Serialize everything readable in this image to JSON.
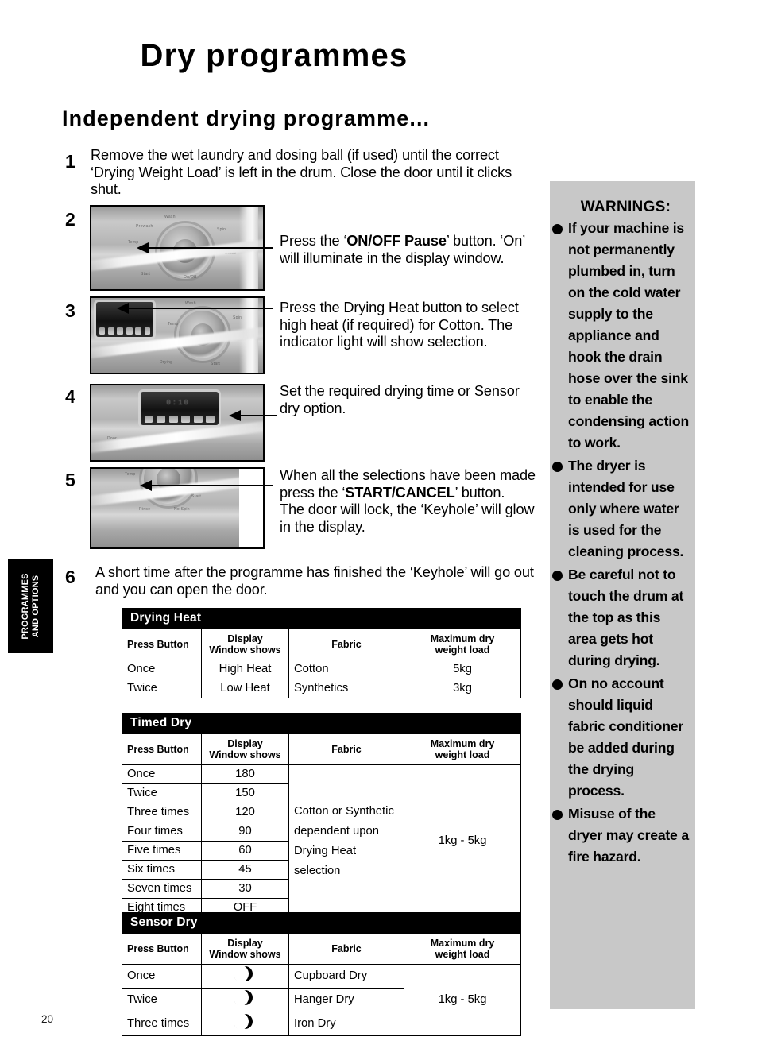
{
  "page": {
    "title": "Dry programmes",
    "section_heading": "Independent drying programme...",
    "page_number": "20",
    "side_tab_line1": "PROGRAMMES",
    "side_tab_line2": "AND OPTIONS"
  },
  "steps": [
    {
      "number": "1",
      "text": "Remove the wet laundry and dosing ball (if used) until the correct ‘Drying Weight Load’ is left in the drum. Close the door until it clicks shut."
    },
    {
      "number": "2",
      "text_lead": "Press the ‘",
      "text_bold": "ON/OFF Pause",
      "text_tail": "’ button. ‘On’ will illuminate in the display window.",
      "photo_alt": "washer-control-panel-dial"
    },
    {
      "number": "3",
      "text": "Press the Drying Heat button to select high heat (if required) for Cotton. The indicator light will show selection.",
      "photo_alt": "washer-control-panel-display"
    },
    {
      "number": "4",
      "text": "Set the required drying time or Sensor dry option.",
      "photo_alt": "washer-display-window-closeup"
    },
    {
      "number": "5",
      "text_lead": "When all the selections have been made press the ‘",
      "text_bold": "START/CANCEL",
      "text_tail": "’ button.",
      "text_line2": "The door will lock, the ‘Keyhole’ will glow in the display.",
      "photo_alt": "washer-control-panel-start-button"
    },
    {
      "number": "6",
      "text": "A short time after the programme has finished the ‘Keyhole’ will go out and you can open the door."
    }
  ],
  "tables": [
    {
      "title": "Drying Heat",
      "columns": [
        "Press Button",
        "Display\nWindow shows",
        "Fabric",
        "Maximum dry\nweight load"
      ],
      "col_head_1a": "Display",
      "col_head_1b": "Window shows",
      "col_head_3a": "Maximum dry",
      "col_head_3b": "weight load",
      "rows": [
        [
          "Once",
          "High Heat",
          "Cotton",
          "5kg"
        ],
        [
          "Twice",
          "Low Heat",
          "Synthetics",
          "3kg"
        ]
      ]
    },
    {
      "title": "Timed Dry",
      "col_head_0": "Press Button",
      "col_head_1a": "Display",
      "col_head_1b": "Window shows",
      "col_head_2": "Fabric",
      "col_head_3a": "Maximum dry",
      "col_head_3b": "weight load",
      "rows": [
        [
          "Once",
          "180"
        ],
        [
          "Twice",
          "150"
        ],
        [
          "Three times",
          "120"
        ],
        [
          "Four times",
          "90"
        ],
        [
          "Five times",
          "60"
        ],
        [
          "Six times",
          "45"
        ],
        [
          "Seven times",
          "30"
        ],
        [
          "Eight times",
          "OFF"
        ]
      ],
      "fabric_merged": "Cotton or Synthetic dependent upon Drying Heat selection",
      "weight_merged": "1kg - 5kg"
    },
    {
      "title": "Sensor Dry",
      "col_head_0": "Press Button",
      "col_head_1a": "Display",
      "col_head_1b": "Window shows",
      "col_head_2": "Fabric",
      "col_head_3a": "Maximum dry",
      "col_head_3b": "weight load",
      "rows": [
        {
          "press": "Once",
          "display_icon": "crescent-moon-icon",
          "fabric": "Cupboard Dry"
        },
        {
          "press": "Twice",
          "display_icon": "crescent-moon-icon",
          "fabric": "Hanger Dry"
        },
        {
          "press": "Three times",
          "display_icon": "crescent-moon-icon",
          "fabric": "Iron Dry"
        }
      ],
      "weight_merged": "1kg - 5kg"
    }
  ],
  "table_headers": {
    "press_button": "Press Button",
    "display_a": "Display",
    "display_b": "Window shows",
    "fabric": "Fabric",
    "max_a": "Maximum dry",
    "max_b": "weight load"
  },
  "warnings": {
    "title": "WARNINGS:",
    "items": [
      "If your machine is not permanently plumbed in, turn on the cold water supply to the appliance and hook the drain hose over the sink to enable the condensing action to work.",
      "The dryer is intended for use only where water is used for the cleaning process.",
      "Be careful not to touch the drum at the top as this area gets hot during drying.",
      "On no account should liquid fabric conditioner be added during the drying process.",
      "Misuse of the dryer may create a fire hazard."
    ]
  },
  "colors": {
    "warning_panel_bg": "#c8c8c8",
    "table_header_bg": "#000000",
    "text": "#000000"
  },
  "photo_labels": {
    "p2": [
      "Wash",
      "Spin",
      "Rinse",
      "Prewash",
      "Temp",
      "Start"
    ],
    "p3": [
      "Wash",
      "Spin",
      "Drying",
      "Temp",
      "Start"
    ],
    "p4_digits": "0:10"
  }
}
